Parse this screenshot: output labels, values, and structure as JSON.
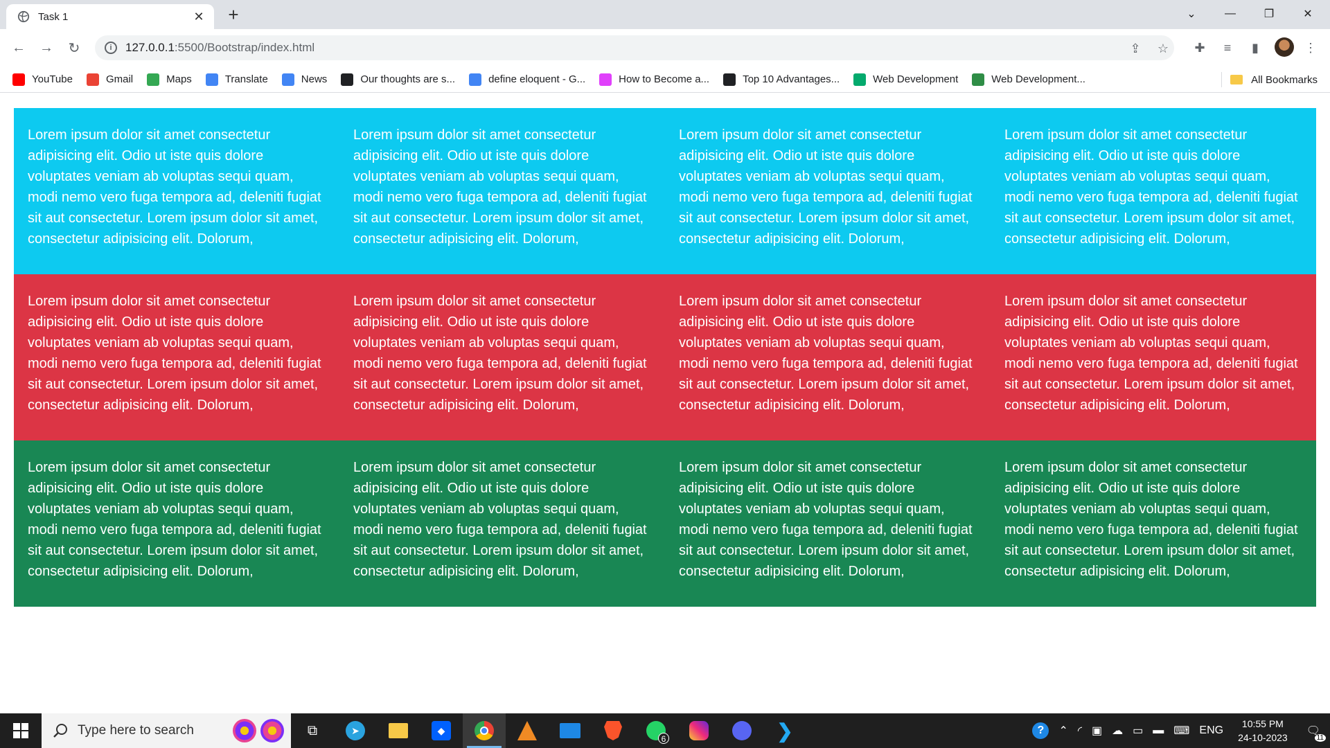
{
  "browser": {
    "tab_title": "Task 1",
    "url_host": "127.0.0.1",
    "url_rest": ":5500/Bootstrap/index.html"
  },
  "bookmarks": [
    {
      "label": "YouTube",
      "icon": "youtube-icon",
      "color": "#ff0000"
    },
    {
      "label": "Gmail",
      "icon": "gmail-icon",
      "color": "#ea4335"
    },
    {
      "label": "Maps",
      "icon": "maps-icon",
      "color": "#34a853"
    },
    {
      "label": "Translate",
      "icon": "translate-icon",
      "color": "#4285f4"
    },
    {
      "label": "News",
      "icon": "news-icon",
      "color": "#4285f4"
    },
    {
      "label": "Our thoughts are s...",
      "icon": "sd-icon",
      "color": "#202124"
    },
    {
      "label": "define eloquent - G...",
      "icon": "google-icon",
      "color": "#4285f4"
    },
    {
      "label": "How to Become a...",
      "icon": "bookmark-site-icon",
      "color": "#e040fb"
    },
    {
      "label": "Top 10 Advantages...",
      "icon": "e-icon",
      "color": "#202124"
    },
    {
      "label": "Web Development",
      "icon": "w3-icon",
      "color": "#04aa6d"
    },
    {
      "label": "Web Development...",
      "icon": "gfg-icon",
      "color": "#2f8d46"
    }
  ],
  "all_bookmarks": "All Bookmarks",
  "content": {
    "text": "Lorem ipsum dolor sit amet consectetur adipisicing elit. Odio ut iste quis dolore voluptates veniam ab voluptas sequi quam, modi nemo vero fuga tempora ad, deleniti fugiat sit aut consectetur. Lorem ipsum dolor sit amet, consectetur adipisicing elit. Dolorum,",
    "row_colors": [
      "#0dcaf0",
      "#dc3545",
      "#198754"
    ]
  },
  "taskbar": {
    "search_placeholder": "Type here to search",
    "whatsapp_badge": "6",
    "language": "ENG",
    "time": "10:55 PM",
    "date": "24-10-2023",
    "notifications": "11"
  }
}
